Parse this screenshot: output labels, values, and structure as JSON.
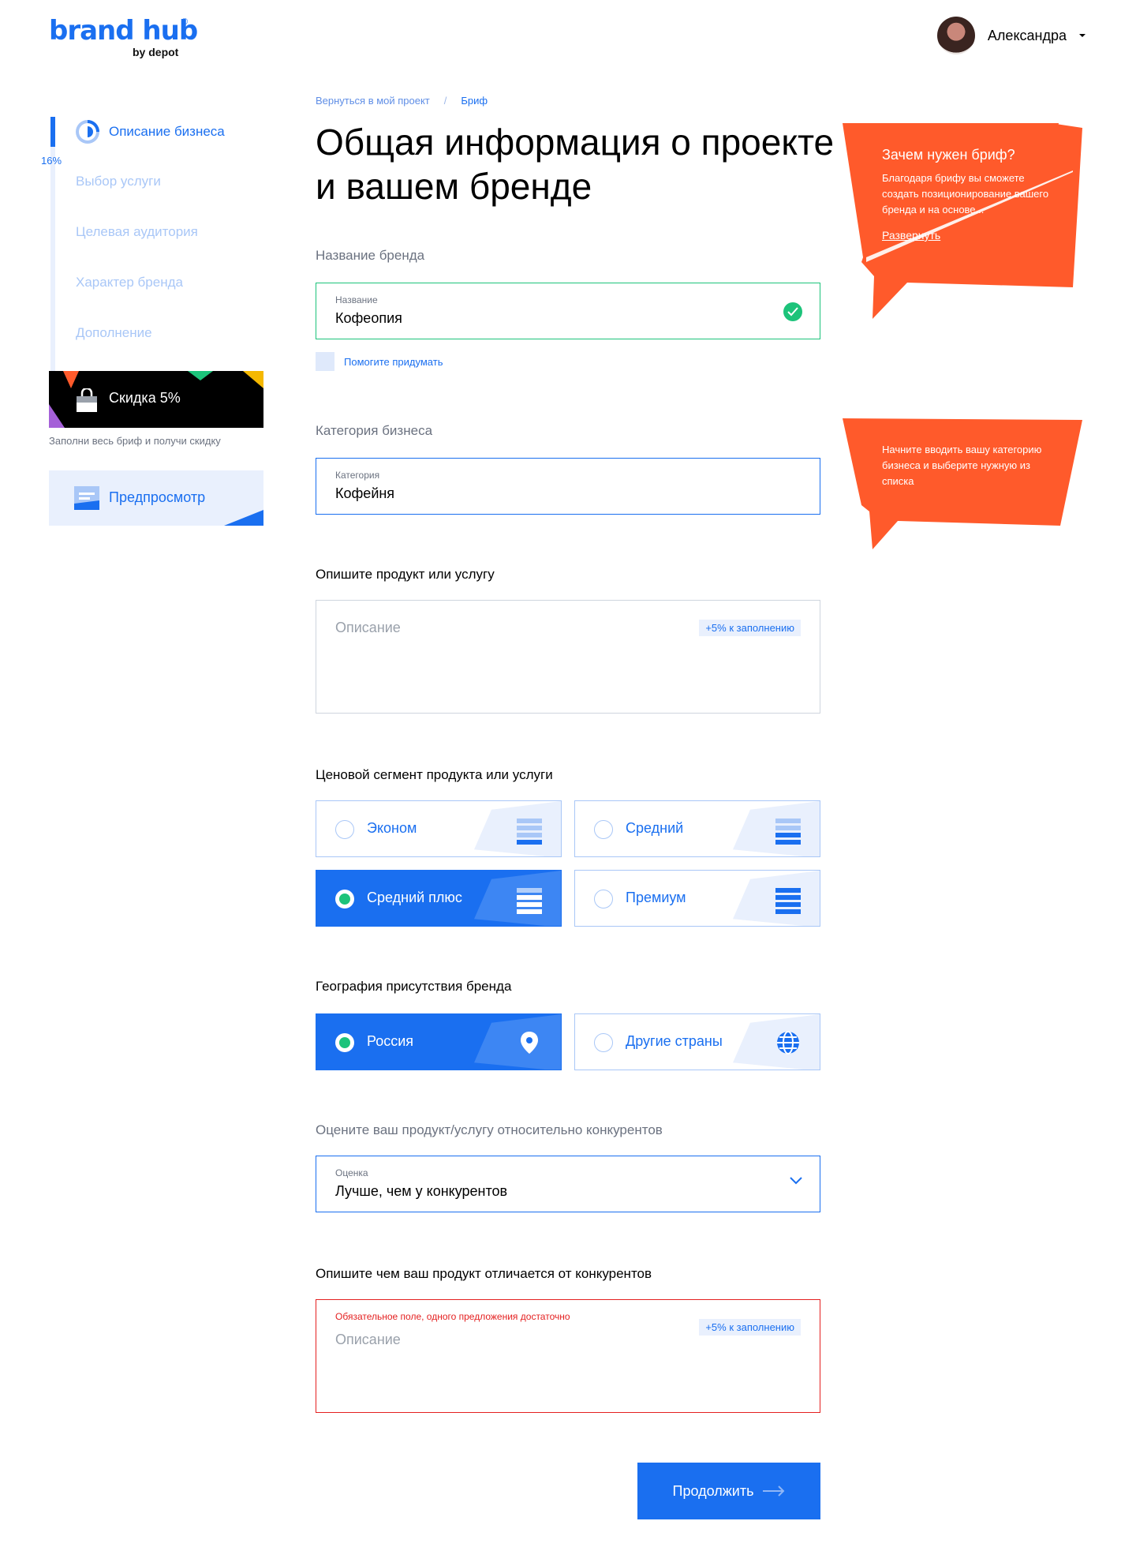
{
  "brand": {
    "name": "brand hub",
    "reg": "®",
    "sub": "by depot"
  },
  "user": {
    "name": "Александра"
  },
  "sidebar": {
    "progress": "16%",
    "steps": [
      {
        "label": "Описание бизнеса"
      },
      {
        "label": "Выбор услуги"
      },
      {
        "label": "Целевая аудитория"
      },
      {
        "label": "Характер бренда"
      },
      {
        "label": "Дополнение"
      }
    ],
    "promo": {
      "label": "Скидка 5%",
      "note": "Заполни весь бриф и получи скидку"
    },
    "preview": {
      "label": "Предпросмотр"
    }
  },
  "breadcrumb": {
    "back": "Вернуться в мой проект",
    "sep": "/",
    "current": "Бриф"
  },
  "page": {
    "title": "Общая информация о проекте и вашем бренде"
  },
  "brand_name": {
    "label": "Название бренда",
    "caption": "Название",
    "value": "Кофеопия",
    "helper": "Помогите придумать"
  },
  "category": {
    "label": "Категория бизнеса",
    "caption": "Категория",
    "value": "Кофейня"
  },
  "product": {
    "label": "Опишите продукт или услугу",
    "placeholder": "Описание",
    "badge": "+5% к заполнению"
  },
  "price": {
    "label": "Ценовой сегмент продукта или услуги",
    "options": [
      {
        "label": "Эконом",
        "selected": false
      },
      {
        "label": "Средний",
        "selected": false
      },
      {
        "label": "Средний плюс",
        "selected": true
      },
      {
        "label": "Премиум",
        "selected": false
      }
    ]
  },
  "geo": {
    "label": "География присутствия бренда",
    "options": [
      {
        "label": "Россия",
        "selected": true,
        "icon": "location-pin-icon"
      },
      {
        "label": "Другие страны",
        "selected": false,
        "icon": "globe-icon"
      }
    ]
  },
  "rating": {
    "label": "Оцените ваш продукт/услугу относительно конкурентов",
    "caption": "Оценка",
    "value": "Лучше, чем у конкурентов"
  },
  "difference": {
    "label": "Опишите чем ваш продукт отличается от конкурентов",
    "error": "Обязательное поле, одного предложения достаточно",
    "placeholder": "Описание",
    "badge": "+5% к заполнению"
  },
  "tips": {
    "brief": {
      "title": "Зачем нужен бриф?",
      "text": "Благодаря брифу вы сможете создать позиционирование вашего бренда и на основе...",
      "link": "Развернуть"
    },
    "category": {
      "text": "Начните вводить вашу категорию бизнеса и выберите нужную из списка"
    }
  },
  "actions": {
    "continue": "Продолжить"
  },
  "colors": {
    "accent": "#1a6ff0",
    "success": "#1cc37a",
    "error": "#e42020",
    "tip": "#ff5a2b"
  }
}
